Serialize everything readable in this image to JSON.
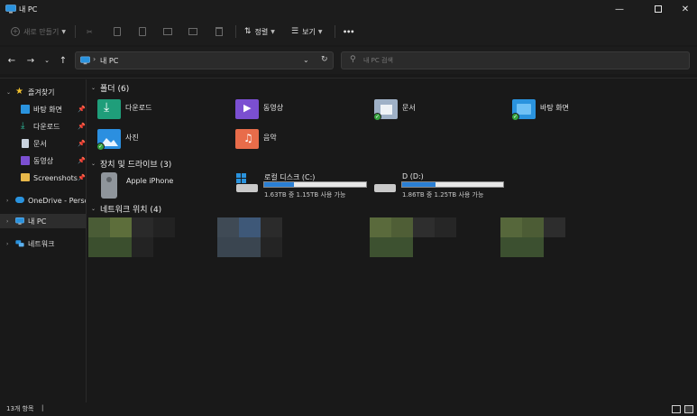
{
  "window": {
    "title": "내 PC",
    "minimize_icon": "minimize-icon",
    "maximize_icon": "maximize-icon",
    "close_icon": "close-icon"
  },
  "toolbar": {
    "new_label": "새로 만들기",
    "sort_label": "정렬",
    "view_label": "보기",
    "more_label": "•••"
  },
  "address": {
    "path": "내 PC",
    "search_placeholder": "내 PC 검색"
  },
  "sidebar": {
    "quick_access": "즐겨찾기",
    "items": [
      {
        "label": "바탕 화면",
        "icon": "desktop-icon"
      },
      {
        "label": "다운로드",
        "icon": "download-icon"
      },
      {
        "label": "문서",
        "icon": "document-icon"
      },
      {
        "label": "동영상",
        "icon": "video-icon"
      },
      {
        "label": "Screenshots",
        "icon": "folder-icon"
      }
    ],
    "onedrive": "OneDrive - Persona",
    "this_pc": "내 PC",
    "network": "네트워크"
  },
  "content": {
    "folders_header": "폴더 (6)",
    "folders": [
      {
        "label": "다운로드",
        "icon": "download-folder-icon",
        "color": "#1f9e7a"
      },
      {
        "label": "동영상",
        "icon": "video-folder-icon",
        "color": "#7b4fd1"
      },
      {
        "label": "문서",
        "icon": "document-folder-icon",
        "color": "#9fb1c7"
      },
      {
        "label": "바탕 화면",
        "icon": "desktop-folder-icon",
        "color": "#2a93de"
      },
      {
        "label": "사진",
        "icon": "pictures-folder-icon",
        "color": "#2b8fe0"
      },
      {
        "label": "음악",
        "icon": "music-folder-icon",
        "color": "#e86c4a"
      }
    ],
    "devices_header": "장치 및 드라이브 (3)",
    "devices": [
      {
        "label": "Apple iPhone",
        "icon": "phone-icon"
      },
      {
        "label": "로컬 디스크 (C:)",
        "icon": "drive-c-icon",
        "usage": "1.63TB 중 1.15TB 사용 가능",
        "used_fraction": 0.29
      },
      {
        "label": "D (D:)",
        "icon": "drive-d-icon",
        "usage": "1.86TB 중 1.25TB 사용 가능",
        "used_fraction": 0.33
      }
    ],
    "network_header": "네트워크 위치 (4)"
  },
  "status": {
    "item_count": "13개 항목"
  },
  "colors": {
    "accent": "#2a7fd4",
    "background": "#191919",
    "chrome": "#1c1c1c",
    "sync_ok": "#35a33f"
  }
}
